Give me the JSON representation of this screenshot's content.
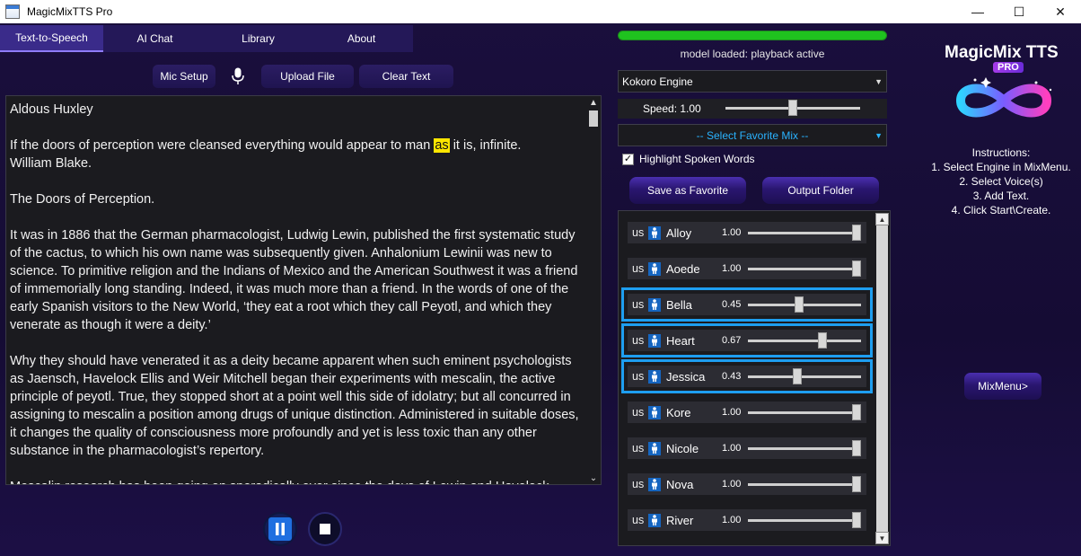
{
  "window": {
    "title": "MagicMixTTS Pro",
    "controls": [
      "—",
      "☐",
      "✕"
    ]
  },
  "tabs": [
    {
      "label": "Text-to-Speech",
      "active": true
    },
    {
      "label": "AI Chat"
    },
    {
      "label": "Library"
    },
    {
      "label": "About"
    }
  ],
  "toolbar": {
    "mic_setup": "Mic Setup",
    "upload_file": "Upload File",
    "clear_text": "Clear Text"
  },
  "editor": {
    "line1": "Aldous Huxley",
    "p2_before": "If the doors of perception were cleansed everything would appear to man ",
    "p2_highlight": "as",
    "p2_after": " it is, infinite.",
    "p2_line2": "William Blake.",
    "p3": "The Doors of Perception.",
    "p4": "It was in 1886 that the German pharmacologist, Ludwig Lewin, published the first systematic study of the cactus, to which his own name was subsequently given. Anhalonium Lewinii was new to science. To primitive religion and the Indians of Mexico and the American Southwest it was a friend of immemorially long standing. Indeed, it was much more than a friend. In the words of one of the early Spanish visitors to the New World, ‘they eat a root which they call Peyotl, and which they venerate as though it were a deity.’",
    "p5": "Why they should have venerated it as a deity became apparent when such eminent psychologists as Jaensch, Havelock Ellis and Weir Mitchell began their experiments with mescalin, the active principle of peyotl. True, they stopped short at a point well this side of idolatry; but all concurred in assigning to mescalin a position among drugs of unique distinction. Administered in suitable doses, it changes the quality of consciousness more profoundly and yet is less toxic than any other substance in the pharmacologist’s repertory.",
    "p6": "Mescalin research has been going on sporadically ever since the days of Lewin and Havelock"
  },
  "progress": {
    "value": 1.0,
    "color": "#1fc21f"
  },
  "status_text": "model loaded: playback active",
  "engine": {
    "selected": "Kokoro Engine"
  },
  "speed": {
    "label": "Speed: 1.00",
    "value": 1.0,
    "min": 0.5,
    "max": 1.5
  },
  "favorite_mix": {
    "selected": "-- Select Favorite Mix --"
  },
  "highlight": {
    "label": "Highlight Spoken Words",
    "checked": true
  },
  "buttons": {
    "save_favorite": "Save as Favorite",
    "output_folder": "Output Folder",
    "mixmenu": "MixMenu>"
  },
  "voices": [
    {
      "lang": "us",
      "name": "Alloy",
      "value": "1.00",
      "level": 1.0,
      "selected": false
    },
    {
      "lang": "us",
      "name": "Aoede",
      "value": "1.00",
      "level": 1.0,
      "selected": false
    },
    {
      "lang": "us",
      "name": "Bella",
      "value": "0.45",
      "level": 0.45,
      "selected": true
    },
    {
      "lang": "us",
      "name": "Heart",
      "value": "0.67",
      "level": 0.67,
      "selected": true
    },
    {
      "lang": "us",
      "name": "Jessica",
      "value": "0.43",
      "level": 0.43,
      "selected": true
    },
    {
      "lang": "us",
      "name": "Kore",
      "value": "1.00",
      "level": 1.0,
      "selected": false
    },
    {
      "lang": "us",
      "name": "Nicole",
      "value": "1.00",
      "level": 1.0,
      "selected": false
    },
    {
      "lang": "us",
      "name": "Nova",
      "value": "1.00",
      "level": 1.0,
      "selected": false
    },
    {
      "lang": "us",
      "name": "River",
      "value": "1.00",
      "level": 1.0,
      "selected": false
    }
  ],
  "brand": {
    "title": "MagicMix TTS",
    "badge": "PRO"
  },
  "instructions": {
    "heading": "Instructions:",
    "steps": [
      "1. Select Engine in MixMenu.",
      "2. Select Voice(s)",
      "3. Add Text.",
      "4. Click Start\\Create."
    ]
  },
  "colors": {
    "accent": "#1e9ef0",
    "progress": "#1fc21f",
    "highlight": "#ffe600"
  }
}
